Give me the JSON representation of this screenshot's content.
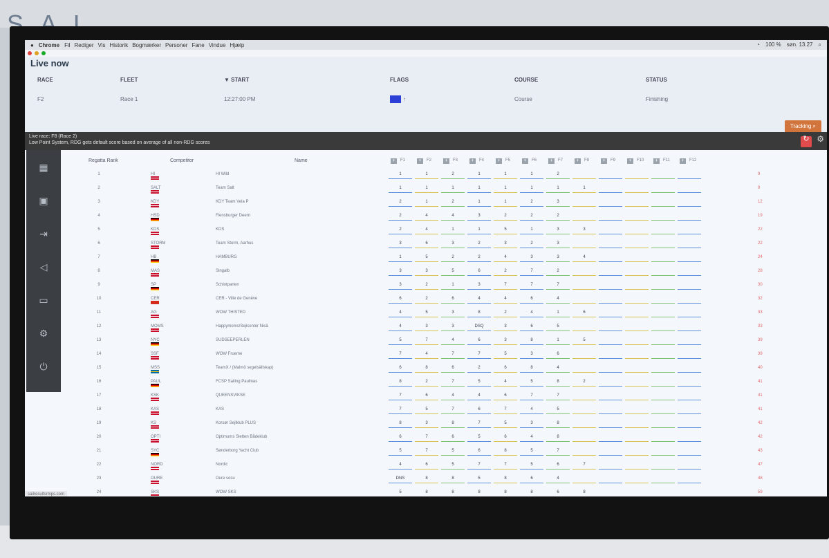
{
  "menubar": {
    "app": "Chrome",
    "items": [
      "Fil",
      "Rediger",
      "Vis",
      "Historik",
      "Bogmærker",
      "Personer",
      "Fane",
      "Vindue",
      "Hjælp"
    ],
    "battery": "100 %",
    "clock": "søn. 13.27"
  },
  "live": {
    "title": "Live now",
    "headers": {
      "race": "RACE",
      "fleet": "FLEET",
      "start": "▼ START",
      "flags": "FLAGS",
      "course": "COURSE",
      "status": "STATUS"
    },
    "row": {
      "race": "F2",
      "fleet": "Race 1",
      "start": "12:27:00 PM",
      "course": "Course",
      "status": "Finishing"
    },
    "tracking_label": "Tracking"
  },
  "info": {
    "line1": "Live race: F8 (Race 2)",
    "line2": "Low Point System, RDG gets default score based on average of all non-RDG scores"
  },
  "table": {
    "headers": {
      "rank": "Regatta Rank",
      "competitor": "Competitor",
      "name": "Name"
    },
    "races": [
      "F1",
      "F2",
      "F3",
      "F4",
      "F5",
      "F6",
      "F7",
      "F8",
      "F9",
      "F10",
      "F11",
      "F12"
    ],
    "rows": [
      {
        "rank": "1",
        "comp": "HI",
        "flag": "dk",
        "name": "HI Wild",
        "scores": [
          "1",
          "1",
          "2",
          "1",
          "1",
          "1",
          "2",
          "",
          "",
          "",
          "",
          ""
        ],
        "total": "9"
      },
      {
        "rank": "2",
        "comp": "SALT",
        "flag": "dk",
        "name": "Team Salt",
        "scores": [
          "1",
          "1",
          "1",
          "1",
          "1",
          "1",
          "1",
          "1",
          "",
          "",
          "",
          ""
        ],
        "total": "9"
      },
      {
        "rank": "3",
        "comp": "KDY",
        "flag": "dk",
        "name": "KDY Team Vela P",
        "scores": [
          "2",
          "1",
          "2",
          "1",
          "1",
          "2",
          "3",
          "",
          "",
          "",
          "",
          ""
        ],
        "total": "12"
      },
      {
        "rank": "4",
        "comp": "HSD",
        "flag": "de",
        "name": "Flensburger Deern",
        "scores": [
          "2",
          "4",
          "4",
          "3",
          "2",
          "2",
          "2",
          "",
          "",
          "",
          "",
          ""
        ],
        "total": "19"
      },
      {
        "rank": "5",
        "comp": "KDS",
        "flag": "dk",
        "name": "KDS",
        "scores": [
          "2",
          "4",
          "1",
          "1",
          "5",
          "1",
          "3",
          "3",
          "",
          "",
          "",
          ""
        ],
        "total": "22"
      },
      {
        "rank": "6",
        "comp": "STORM",
        "flag": "dk",
        "name": "Team Storm, Aarhus",
        "scores": [
          "3",
          "6",
          "3",
          "2",
          "3",
          "2",
          "3",
          "",
          "",
          "",
          "",
          ""
        ],
        "total": "22"
      },
      {
        "rank": "7",
        "comp": "HB",
        "flag": "de",
        "name": "HAMBURG",
        "scores": [
          "1",
          "5",
          "2",
          "2",
          "4",
          "3",
          "3",
          "4",
          "",
          "",
          "",
          ""
        ],
        "total": "24"
      },
      {
        "rank": "8",
        "comp": "MAS",
        "flag": "dk",
        "name": "Singalb",
        "scores": [
          "3",
          "3",
          "5",
          "6",
          "2",
          "7",
          "2",
          "",
          "",
          "",
          "",
          ""
        ],
        "total": "28"
      },
      {
        "rank": "9",
        "comp": "SP",
        "flag": "de",
        "name": "Schlotparten",
        "scores": [
          "3",
          "2",
          "1",
          "3",
          "7",
          "7",
          "7",
          "",
          "",
          "",
          "",
          ""
        ],
        "total": "30"
      },
      {
        "rank": "10",
        "comp": "CER",
        "flag": "ch",
        "name": "CER - Ville de Genève",
        "scores": [
          "6",
          "2",
          "6",
          "4",
          "4",
          "6",
          "4",
          "",
          "",
          "",
          "",
          ""
        ],
        "total": "32"
      },
      {
        "rank": "11",
        "comp": "AG",
        "flag": "dk",
        "name": "WOW THISTED",
        "scores": [
          "4",
          "5",
          "3",
          "8",
          "2",
          "4",
          "1",
          "6",
          "",
          "",
          "",
          ""
        ],
        "total": "33"
      },
      {
        "rank": "12",
        "comp": "MOMS",
        "flag": "dk",
        "name": "Happymoms/Sejlcenter Nisä",
        "scores": [
          "4",
          "3",
          "3",
          "DSQ",
          "3",
          "6",
          "5",
          "",
          "",
          "",
          "",
          ""
        ],
        "total": "33"
      },
      {
        "rank": "13",
        "comp": "NYC",
        "flag": "de",
        "name": "SUDSEEPERLEN",
        "scores": [
          "5",
          "7",
          "4",
          "6",
          "3",
          "8",
          "1",
          "5",
          "",
          "",
          "",
          ""
        ],
        "total": "39"
      },
      {
        "rank": "14",
        "comp": "SSF",
        "flag": "dk",
        "name": "WOW Frueme",
        "scores": [
          "7",
          "4",
          "7",
          "7",
          "5",
          "3",
          "6",
          "",
          "",
          "",
          "",
          ""
        ],
        "total": "39"
      },
      {
        "rank": "15",
        "comp": "MSS",
        "flag": "se",
        "name": "TeamX / (Malmö segelsällskap)",
        "scores": [
          "6",
          "8",
          "6",
          "2",
          "6",
          "8",
          "4",
          "",
          "",
          "",
          "",
          ""
        ],
        "total": "40"
      },
      {
        "rank": "16",
        "comp": "PAUL",
        "flag": "de",
        "name": "FCSP Sailing Paulinas",
        "scores": [
          "8",
          "2",
          "7",
          "5",
          "4",
          "5",
          "8",
          "2",
          "",
          "",
          "",
          ""
        ],
        "total": "41"
      },
      {
        "rank": "17",
        "comp": "KSK",
        "flag": "dk",
        "name": "QUEENSVIKSE",
        "scores": [
          "7",
          "6",
          "4",
          "4",
          "6",
          "7",
          "7",
          "",
          "",
          "",
          "",
          ""
        ],
        "total": "41"
      },
      {
        "rank": "18",
        "comp": "KAS",
        "flag": "dk",
        "name": "KAS",
        "scores": [
          "7",
          "5",
          "7",
          "6",
          "7",
          "4",
          "5",
          "",
          "",
          "",
          "",
          ""
        ],
        "total": "41"
      },
      {
        "rank": "19",
        "comp": "KS",
        "flag": "dk",
        "name": "Korsør Sejlklub PLUS",
        "scores": [
          "8",
          "3",
          "8",
          "7",
          "5",
          "3",
          "8",
          "",
          "",
          "",
          "",
          ""
        ],
        "total": "42"
      },
      {
        "rank": "20",
        "comp": "OPTI",
        "flag": "dk",
        "name": "Optimums Sletten Bådeklub",
        "scores": [
          "6",
          "7",
          "6",
          "5",
          "6",
          "4",
          "8",
          "",
          "",
          "",
          "",
          ""
        ],
        "total": "42"
      },
      {
        "rank": "21",
        "comp": "SYC",
        "flag": "de",
        "name": "Sønderborg Yacht Club",
        "scores": [
          "5",
          "7",
          "5",
          "6",
          "8",
          "5",
          "7",
          "",
          "",
          "",
          "",
          ""
        ],
        "total": "43"
      },
      {
        "rank": "22",
        "comp": "NORD",
        "flag": "dk",
        "name": "Nordic",
        "scores": [
          "4",
          "6",
          "5",
          "7",
          "7",
          "5",
          "6",
          "7",
          "",
          "",
          "",
          ""
        ],
        "total": "47"
      },
      {
        "rank": "23",
        "comp": "OURE",
        "flag": "dk",
        "name": "Oure sosu",
        "scores": [
          "DNS",
          "8",
          "8",
          "5",
          "8",
          "6",
          "4",
          "",
          "",
          "",
          "",
          ""
        ],
        "total": "48"
      },
      {
        "rank": "24",
        "comp": "SKS",
        "flag": "dk",
        "name": "WOW SKS",
        "scores": [
          "5",
          "8",
          "8",
          "8",
          "8",
          "8",
          "6",
          "8",
          "",
          "",
          "",
          ""
        ],
        "total": "59"
      }
    ]
  },
  "status_url": "sailresultsrmps.com",
  "colors": {
    "accent": "#d2753c",
    "sidebar": "#3b3f44",
    "flag_blue": "#2c3fd6",
    "refresh": "#e24b4b"
  }
}
